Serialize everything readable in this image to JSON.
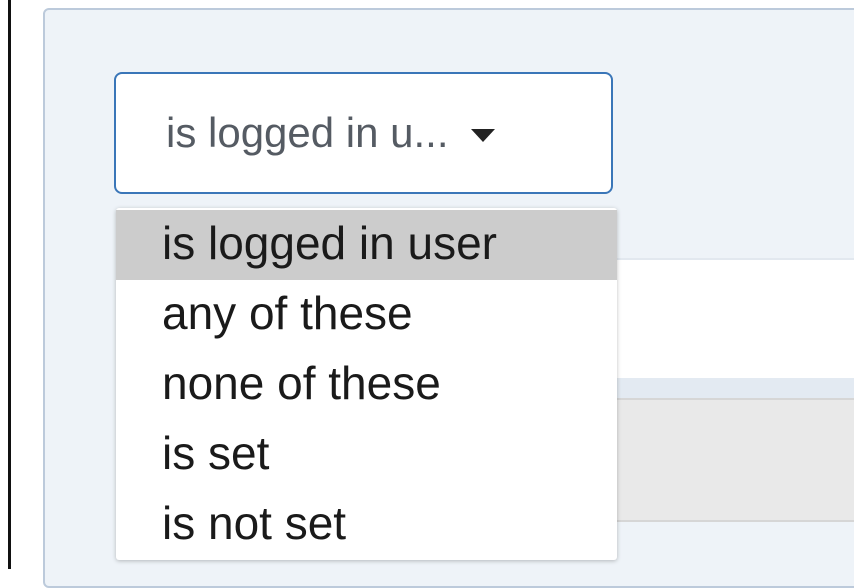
{
  "filter": {
    "selected_value": "is logged in u...",
    "caret_icon": "caret-down-icon",
    "options": [
      {
        "label": "is logged in user",
        "highlighted": true
      },
      {
        "label": "any of these",
        "highlighted": false
      },
      {
        "label": "none of these",
        "highlighted": false
      },
      {
        "label": "is set",
        "highlighted": false
      },
      {
        "label": "is not set",
        "highlighted": false
      }
    ]
  },
  "colors": {
    "accent_border": "#3a76b8",
    "highlight": "#cccccc",
    "panel_bg": "#eef3f8"
  }
}
